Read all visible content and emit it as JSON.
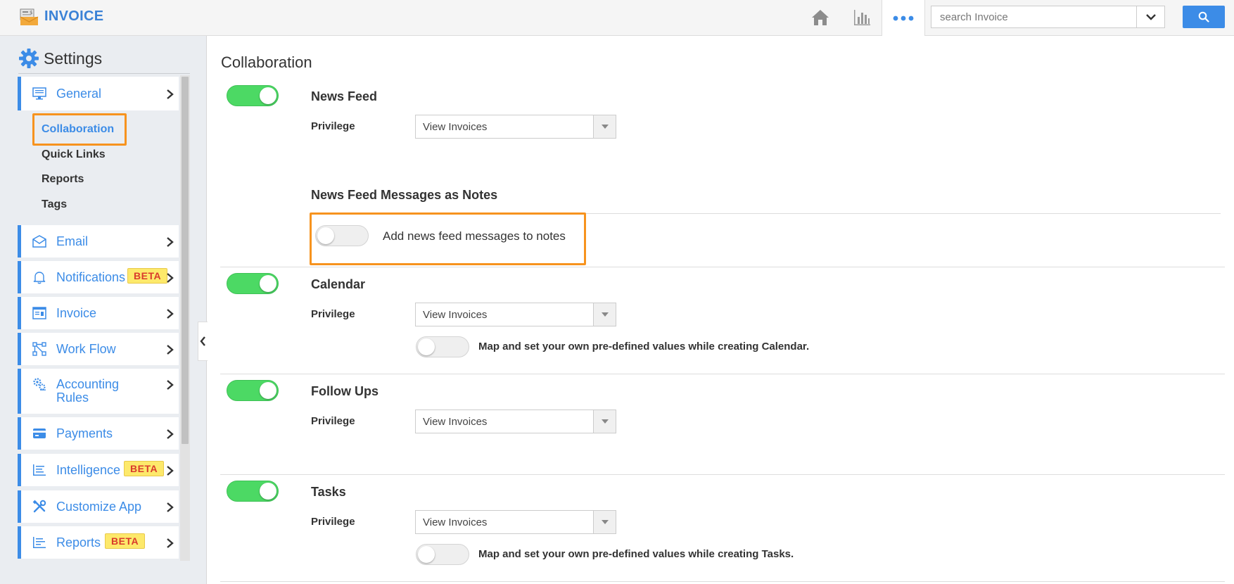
{
  "app": {
    "title": "INVOICE",
    "search_placeholder": "search Invoice"
  },
  "colors": {
    "accent": "#3c8ce7",
    "toggle_on": "#4cd964",
    "highlight": "#f7931e",
    "beta_bg": "#fde96b",
    "beta_text": "#d93b2c"
  },
  "sidebar": {
    "title": "Settings",
    "items": [
      {
        "label": "General",
        "icon": "monitor-icon"
      },
      {
        "label": "Email",
        "icon": "envelope-icon"
      },
      {
        "label": "Notifications",
        "icon": "bell-icon",
        "badge": "BETA"
      },
      {
        "label": "Invoice",
        "icon": "invoice-icon"
      },
      {
        "label": "Work Flow",
        "icon": "workflow-icon"
      },
      {
        "label": "Accounting Rules",
        "icon": "gears-icon"
      },
      {
        "label": "Payments",
        "icon": "card-icon"
      },
      {
        "label": "Intelligence",
        "icon": "chart-lines-icon",
        "badge": "BETA"
      },
      {
        "label": "Customize App",
        "icon": "tools-icon"
      },
      {
        "label": "Reports",
        "icon": "report-icon",
        "badge": "BETA"
      }
    ],
    "general_sub": [
      "Collaboration",
      "Quick Links",
      "Reports",
      "Tags"
    ]
  },
  "main": {
    "title": "Collaboration",
    "sections": [
      {
        "title": "News Feed",
        "privilege_label": "Privilege",
        "privilege_value": "View Invoices",
        "enabled": true
      },
      {
        "title": "News Feed Messages as Notes",
        "toggle_text": "Add news feed messages to notes",
        "enabled": false
      },
      {
        "title": "Calendar",
        "privilege_label": "Privilege",
        "privilege_value": "View Invoices",
        "map_text": "Map and set your own pre-defined values while creating Calendar.",
        "enabled": true
      },
      {
        "title": "Follow Ups",
        "privilege_label": "Privilege",
        "privilege_value": "View Invoices",
        "enabled": true
      },
      {
        "title": "Tasks",
        "privilege_label": "Privilege",
        "privilege_value": "View Invoices",
        "map_text": "Map and set your own pre-defined values while creating Tasks.",
        "enabled": true
      }
    ]
  }
}
